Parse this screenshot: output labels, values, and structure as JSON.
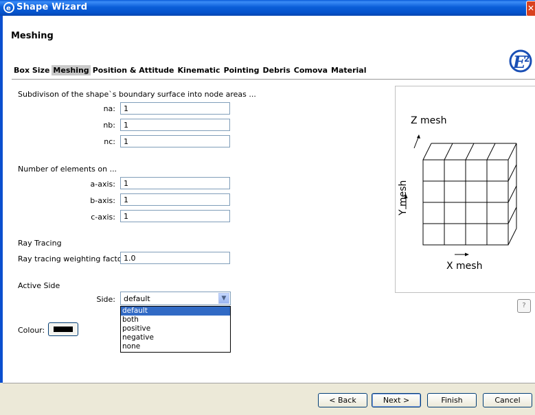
{
  "window": {
    "title": "Shape Wizard",
    "close_glyph": "✕"
  },
  "header": {
    "heading": "Meshing"
  },
  "tabs": [
    {
      "label": "Box Size",
      "active": false
    },
    {
      "label": "Meshing",
      "active": true
    },
    {
      "label": "Position & Attitude",
      "active": false
    },
    {
      "label": "Kinematic",
      "active": false
    },
    {
      "label": "Pointing",
      "active": false
    },
    {
      "label": "Debris",
      "active": false
    },
    {
      "label": "Comova",
      "active": false
    },
    {
      "label": "Material",
      "active": false
    }
  ],
  "subdivision": {
    "heading": "Subdivison of the shape`s boundary surface into node areas ...",
    "na_label": "na:",
    "na_value": "1",
    "nb_label": "nb:",
    "nb_value": "1",
    "nc_label": "nc:",
    "nc_value": "1"
  },
  "elements": {
    "heading": "Number of elements on ...",
    "a_label": "a-axis:",
    "a_value": "1",
    "b_label": "b-axis:",
    "b_value": "1",
    "c_label": "c-axis:",
    "c_value": "1"
  },
  "ray_tracing": {
    "heading": "Ray Tracing",
    "factor_label": "Ray tracing weighting factor:",
    "factor_value": "1.0"
  },
  "active_side": {
    "heading": "Active Side",
    "side_label": "Side:",
    "selected": "default",
    "options": [
      "default",
      "both",
      "positive",
      "negative",
      "none"
    ]
  },
  "colour": {
    "label": "Colour:",
    "value": "#000000"
  },
  "preview": {
    "z_label": "Z mesh",
    "y_label": "Y mesh",
    "x_label": "X mesh"
  },
  "footer": {
    "back_label": "< Back",
    "next_label": "Next >",
    "finish_label": "Finish",
    "cancel_label": "Cancel"
  },
  "icons": {
    "app": "e2-logo-icon",
    "help": "help-icon",
    "dropdown": "chevron-down-icon"
  }
}
